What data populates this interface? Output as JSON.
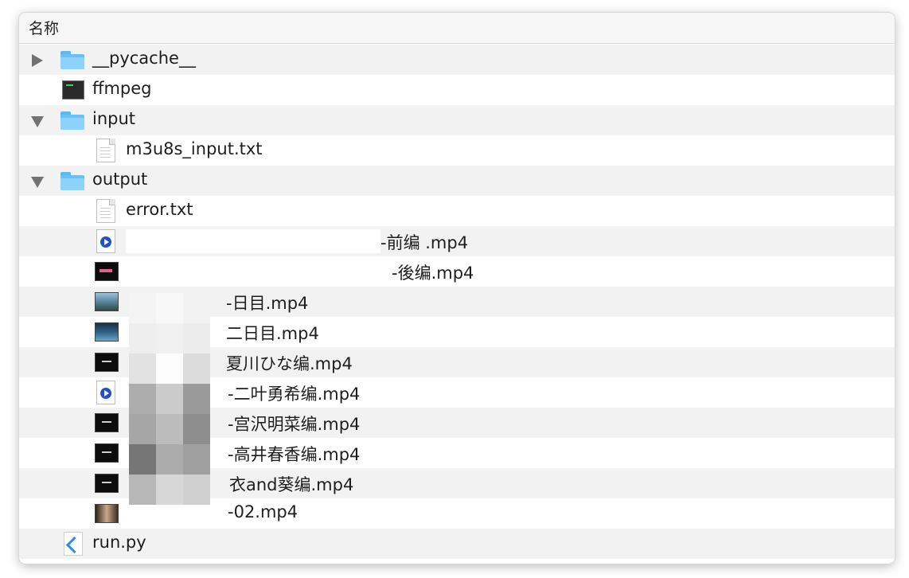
{
  "header": {
    "column_name": "名称"
  },
  "rows": [
    {
      "name": "__pycache__",
      "type": "folder",
      "expanded": false
    },
    {
      "name": "ffmpeg",
      "type": "executable"
    },
    {
      "name": "input",
      "type": "folder",
      "expanded": true
    },
    {
      "name": "m3u8s_input.txt",
      "type": "text-file"
    },
    {
      "name": "output",
      "type": "folder",
      "expanded": true
    },
    {
      "name": "error.txt",
      "type": "text-file"
    },
    {
      "name": "-前编 .mp4",
      "type": "video-file"
    },
    {
      "name": "-後编.mp4",
      "type": "video-thumbnail"
    },
    {
      "name": "-日目.mp4",
      "type": "video-thumbnail"
    },
    {
      "name": "二日目.mp4",
      "type": "video-thumbnail"
    },
    {
      "name": "夏川ひな编.mp4",
      "type": "video-thumbnail"
    },
    {
      "name": "-二叶勇希编.mp4",
      "type": "video-file"
    },
    {
      "name": "-宫沢明菜编.mp4",
      "type": "video-thumbnail"
    },
    {
      "name": "-高井春香编.mp4",
      "type": "video-thumbnail"
    },
    {
      "name": "衣and葵编.mp4",
      "type": "video-thumbnail"
    },
    {
      "name": "-02.mp4",
      "type": "video-thumbnail"
    },
    {
      "name": "run.py",
      "type": "python-file"
    }
  ]
}
